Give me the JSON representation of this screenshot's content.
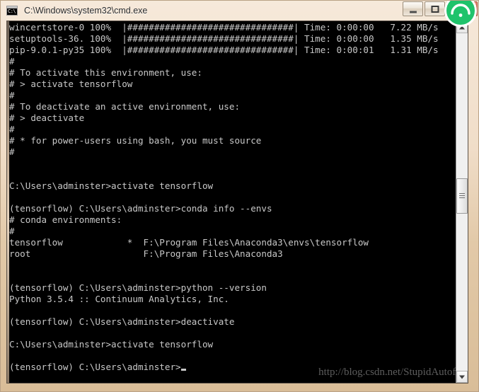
{
  "window": {
    "title": "C:\\Windows\\system32\\cmd.exe",
    "icon_name": "cmd-icon",
    "icon_glyph": "C:\\",
    "buttons": {
      "minimize_label": "—",
      "maximize_label": "",
      "close_label": "✕"
    },
    "frame_color": "#e2c9a8",
    "close_color": "#c0402c"
  },
  "badge": {
    "name": "green-circle-badge",
    "color": "#1fc36b"
  },
  "console": {
    "background": "#000000",
    "foreground": "#c8c8c8",
    "lines": [
      "wincertstore-0 100%  |###############################| Time: 0:00:00   7.22 MB/s",
      "setuptools-36. 100%  |###############################| Time: 0:00:00   1.35 MB/s",
      "pip-9.0.1-py35 100%  |###############################| Time: 0:00:01   1.31 MB/s",
      "#",
      "# To activate this environment, use:",
      "# > activate tensorflow",
      "#",
      "# To deactivate an active environment, use:",
      "# > deactivate",
      "#",
      "# * for power-users using bash, you must source",
      "#",
      "",
      "",
      "C:\\Users\\adminster>activate tensorflow",
      "",
      "(tensorflow) C:\\Users\\adminster>conda info --envs",
      "# conda environments:",
      "#",
      "tensorflow            *  F:\\Program Files\\Anaconda3\\envs\\tensorflow",
      "root                     F:\\Program Files\\Anaconda3",
      "",
      "",
      "(tensorflow) C:\\Users\\adminster>python --version",
      "Python 3.5.4 :: Continuum Analytics, Inc.",
      "",
      "(tensorflow) C:\\Users\\adminster>deactivate",
      "",
      "C:\\Users\\adminster>activate tensorflow",
      "",
      "(tensorflow) C:\\Users\\adminster>"
    ]
  },
  "watermark": {
    "text": "http://blog.csdn.net/StupidAutofa"
  },
  "scrollbar": {
    "up_arrow_name": "scroll-up-arrow",
    "down_arrow_name": "scroll-down-arrow"
  }
}
